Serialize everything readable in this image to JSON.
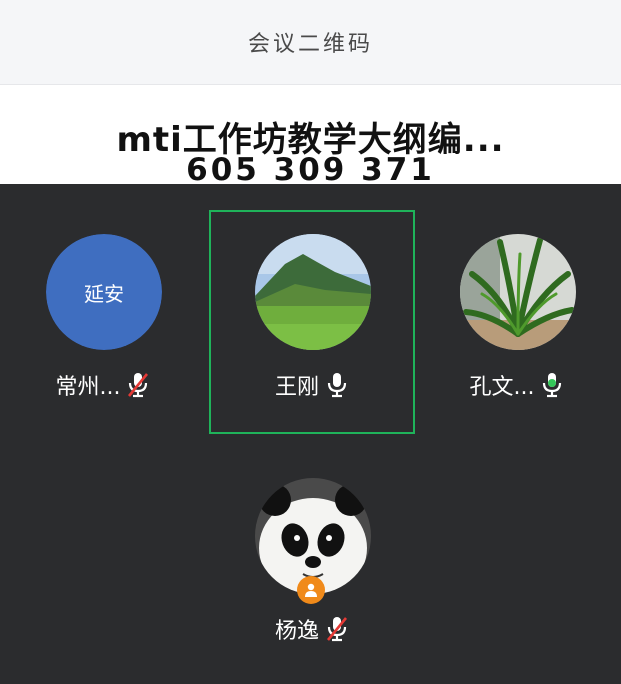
{
  "header": {
    "title": "会议二维码"
  },
  "meeting": {
    "name": "mti工作坊教学大纲编...",
    "id": "605 309 371"
  },
  "participants": [
    {
      "name": "常州...",
      "avatar_text": "延安",
      "mic": "muted"
    },
    {
      "name": "王刚",
      "avatar_icon": "mountain-landscape",
      "mic": "on",
      "active_speaker": true
    },
    {
      "name": "孔文...",
      "avatar_icon": "palm-plant",
      "mic": "speaking"
    },
    {
      "name": "杨逸",
      "avatar_icon": "panda",
      "mic": "muted",
      "host": true
    }
  ],
  "colors": {
    "active_border": "#1fb35a",
    "muted_slash": "#e53935",
    "speaking_green": "#34c759",
    "avatar_blue": "#3f6ec0",
    "host_badge": "#f08a1a",
    "background": "#2b2c2e"
  }
}
